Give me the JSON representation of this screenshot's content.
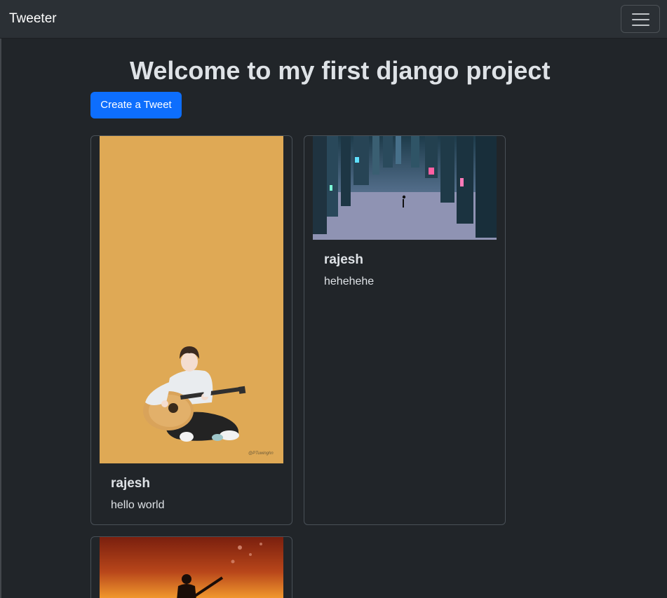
{
  "navbar": {
    "brand": "Tweeter",
    "toggler_icon": "hamburger-menu-icon"
  },
  "main": {
    "heading": "Welcome to my first django project",
    "create_button": "Create a Tweet"
  },
  "tweets": [
    {
      "author": "rajesh",
      "text": "hello world",
      "image": "guitarist-illustration",
      "watermark": "@PTuwinghn"
    },
    {
      "author": "rajesh",
      "text": "hehehehe",
      "image": "upside-down-city-scene"
    },
    {
      "author": "",
      "text": "",
      "image": "sunset-guitar-silhouette"
    }
  ],
  "colors": {
    "background": "#212529",
    "navbar": "#2b3035",
    "primary": "#0d6efd",
    "card_border": "#495057",
    "text": "#dee2e6"
  }
}
